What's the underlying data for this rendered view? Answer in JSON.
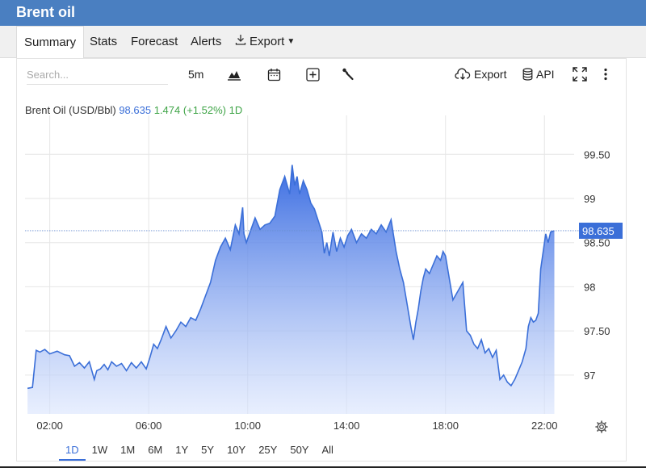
{
  "app": {
    "title": "Brent oil"
  },
  "tabs": [
    {
      "label": "Summary",
      "active": true
    },
    {
      "label": "Stats"
    },
    {
      "label": "Forecast"
    },
    {
      "label": "Alerts"
    },
    {
      "label": "Export"
    }
  ],
  "toolbar": {
    "search_placeholder": "Search...",
    "interval": "5m",
    "export_label": "Export",
    "api_label": "API"
  },
  "legend": {
    "name": "Brent Oil (USD/Bbl)",
    "price": "98.635",
    "change": "1.474 (+1.52%)",
    "period": "1D"
  },
  "ranges": [
    "1D",
    "1W",
    "1M",
    "6M",
    "1Y",
    "5Y",
    "10Y",
    "25Y",
    "50Y",
    "All"
  ],
  "active_range": "1D",
  "colors": {
    "header": "#4a7fc1",
    "line": "#3b6fd8",
    "change": "#3fa447"
  },
  "chart_data": {
    "type": "area",
    "xlabel": "",
    "ylabel": "",
    "x_ticks": [
      "02:00",
      "06:00",
      "10:00",
      "14:00",
      "18:00",
      "22:00"
    ],
    "x_tick_hours": [
      2,
      6,
      10,
      14,
      18,
      22
    ],
    "y_ticks": [
      97,
      97.5,
      98,
      98.5,
      99,
      99.5
    ],
    "y_tick_labels": [
      "97",
      "97.50",
      "98",
      "98.50",
      "99",
      "99.50"
    ],
    "ylim": [
      96.56,
      99.85
    ],
    "xlim_hours": [
      1.0,
      23.2
    ],
    "last_value": 98.635,
    "last_value_label": "98.635",
    "grid": true,
    "series": [
      {
        "x": [
          1.1,
          1.3,
          1.45,
          1.6,
          1.8,
          2.0,
          2.3,
          2.6,
          2.8,
          3.0,
          3.2,
          3.4,
          3.6,
          3.8,
          3.9,
          4.05,
          4.2,
          4.35,
          4.5,
          4.7,
          4.9,
          5.1,
          5.3,
          5.5,
          5.7,
          5.9,
          6.05,
          6.2,
          6.35,
          6.5,
          6.7,
          6.9,
          7.1,
          7.3,
          7.5,
          7.7,
          7.9,
          8.1,
          8.3,
          8.5,
          8.7,
          8.9,
          9.1,
          9.3,
          9.5,
          9.65,
          9.8,
          9.85,
          9.95,
          10.1,
          10.3,
          10.5,
          10.7,
          10.9,
          11.1,
          11.3,
          11.5,
          11.7,
          11.8,
          11.9,
          12.0,
          12.1,
          12.25,
          12.4,
          12.55,
          12.7,
          12.85,
          13.0,
          13.1,
          13.2,
          13.3,
          13.45,
          13.6,
          13.75,
          13.9,
          14.05,
          14.2,
          14.4,
          14.6,
          14.8,
          15.0,
          15.2,
          15.4,
          15.6,
          15.8,
          16.0,
          16.15,
          16.3,
          16.45,
          16.6,
          16.7,
          16.8,
          16.9,
          17.0,
          17.1,
          17.2,
          17.35,
          17.5,
          17.65,
          17.8,
          17.9,
          18.0,
          18.15,
          18.3,
          18.5,
          18.7,
          18.85,
          19.0,
          19.15,
          19.3,
          19.45,
          19.6,
          19.75,
          19.9,
          20.05,
          20.2,
          20.35,
          20.5,
          20.65,
          20.8,
          20.95,
          21.1,
          21.25,
          21.35,
          21.45,
          21.55,
          21.65,
          21.75,
          21.85,
          21.95,
          22.05,
          22.15,
          22.25,
          22.4
        ],
        "y": [
          96.85,
          96.86,
          97.28,
          97.26,
          97.29,
          97.24,
          97.27,
          97.23,
          97.22,
          97.1,
          97.14,
          97.08,
          97.15,
          96.95,
          97.05,
          97.07,
          97.12,
          97.06,
          97.15,
          97.1,
          97.13,
          97.05,
          97.14,
          97.08,
          97.15,
          97.07,
          97.2,
          97.35,
          97.3,
          97.4,
          97.55,
          97.42,
          97.5,
          97.6,
          97.55,
          97.65,
          97.62,
          97.75,
          97.9,
          98.05,
          98.3,
          98.45,
          98.55,
          98.42,
          98.7,
          98.6,
          98.9,
          98.6,
          98.5,
          98.62,
          98.78,
          98.65,
          98.7,
          98.72,
          98.8,
          99.1,
          99.25,
          99.05,
          99.38,
          99.15,
          99.25,
          99.05,
          99.2,
          99.1,
          98.95,
          98.88,
          98.75,
          98.62,
          98.38,
          98.5,
          98.35,
          98.62,
          98.4,
          98.55,
          98.45,
          98.58,
          98.65,
          98.5,
          98.6,
          98.55,
          98.65,
          98.6,
          98.7,
          98.62,
          98.76,
          98.4,
          98.2,
          98.05,
          97.8,
          97.55,
          97.4,
          97.6,
          97.75,
          97.95,
          98.1,
          98.2,
          98.15,
          98.25,
          98.35,
          98.3,
          98.4,
          98.35,
          98.1,
          97.85,
          97.95,
          98.05,
          97.5,
          97.45,
          97.35,
          97.3,
          97.4,
          97.25,
          97.3,
          97.2,
          97.28,
          96.95,
          97.0,
          96.92,
          96.88,
          96.95,
          97.05,
          97.15,
          97.3,
          97.55,
          97.65,
          97.6,
          97.62,
          97.7,
          98.2,
          98.4,
          98.6,
          98.5,
          98.62,
          98.635
        ]
      }
    ]
  }
}
